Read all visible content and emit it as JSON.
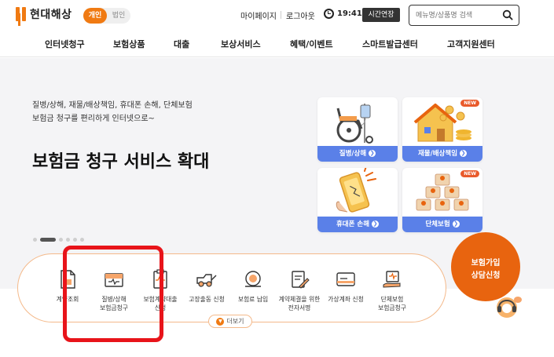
{
  "header": {
    "logo_text": "현대해상",
    "toggle": [
      "개인",
      "법인"
    ],
    "mypage": "마이페이지",
    "logout": "로그아웃",
    "time": "19:41",
    "extend": "시간연장",
    "search_placeholder": "메뉴명/상품명 검색"
  },
  "nav": [
    "인터넷청구",
    "보험상품",
    "대출",
    "보상서비스",
    "혜택/이벤트",
    "스마트발급센터",
    "고객지원센터"
  ],
  "hero": {
    "subtitle_1": "질병/상해, 재물/배상책임, 휴대폰 손해, 단체보험",
    "subtitle_2": "보험금 청구를 편리하게 인터넷으로~",
    "title": "보험금 청구 서비스 확대"
  },
  "cards": [
    {
      "label": "질병/상해",
      "badge": ""
    },
    {
      "label": "재물/배상책임",
      "badge": "NEW"
    },
    {
      "label": "휴대폰 손해",
      "badge": ""
    },
    {
      "label": "단체보험",
      "badge": "NEW"
    }
  ],
  "arrow_glyph": "❯",
  "services": {
    "items": [
      {
        "label": "계약조회"
      },
      {
        "label": "질병/상해\n보험금청구"
      },
      {
        "label": "보험계약대출\n신청"
      },
      {
        "label": "고장출동 신청"
      },
      {
        "label": "보험료 납입"
      },
      {
        "label": "계약체결을 위한\n전자서명"
      },
      {
        "label": "가상계좌 신청"
      },
      {
        "label": "단체보험\n보험금청구"
      }
    ],
    "more": "더보기"
  },
  "join": {
    "line1": "보험가입",
    "line2": "상담신청"
  },
  "colors": {
    "brand": "#f07a12",
    "card_label": "#5a80e8",
    "highlight": "#e8141a"
  }
}
